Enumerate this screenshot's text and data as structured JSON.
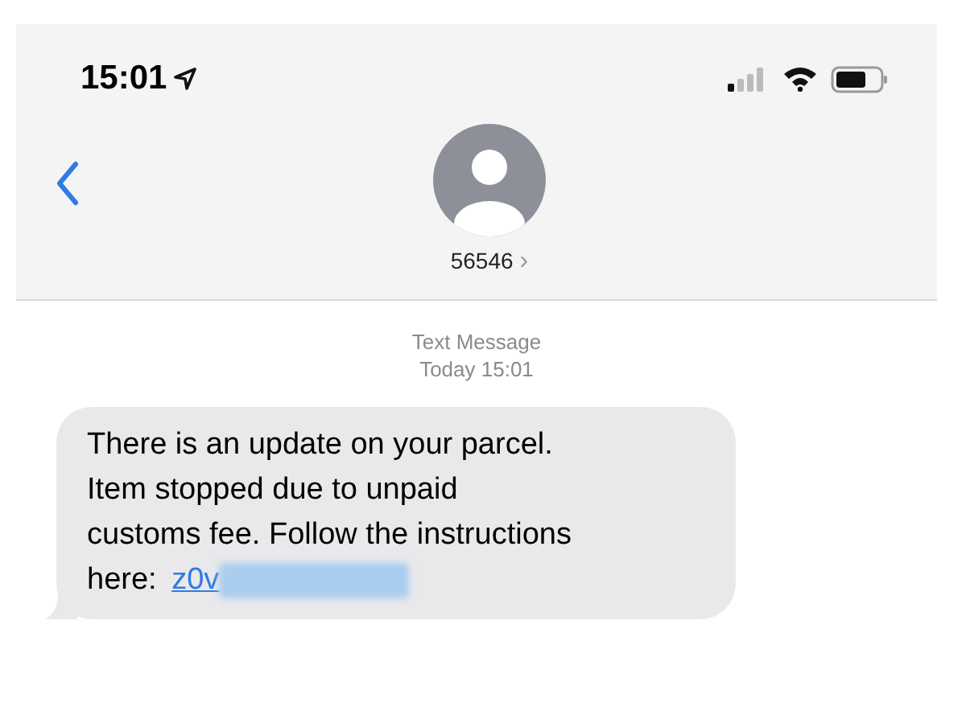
{
  "status_bar": {
    "time": "15:01"
  },
  "header": {
    "contact": "56546",
    "chevron": "›"
  },
  "thread": {
    "service": "Text Message",
    "timestamp": "Today 15:01"
  },
  "message": {
    "lines": [
      "There is an update on your parcel.",
      "Item stopped due to unpaid",
      "customs fee. Follow the instructions",
      "here: "
    ],
    "link": "z0v"
  }
}
